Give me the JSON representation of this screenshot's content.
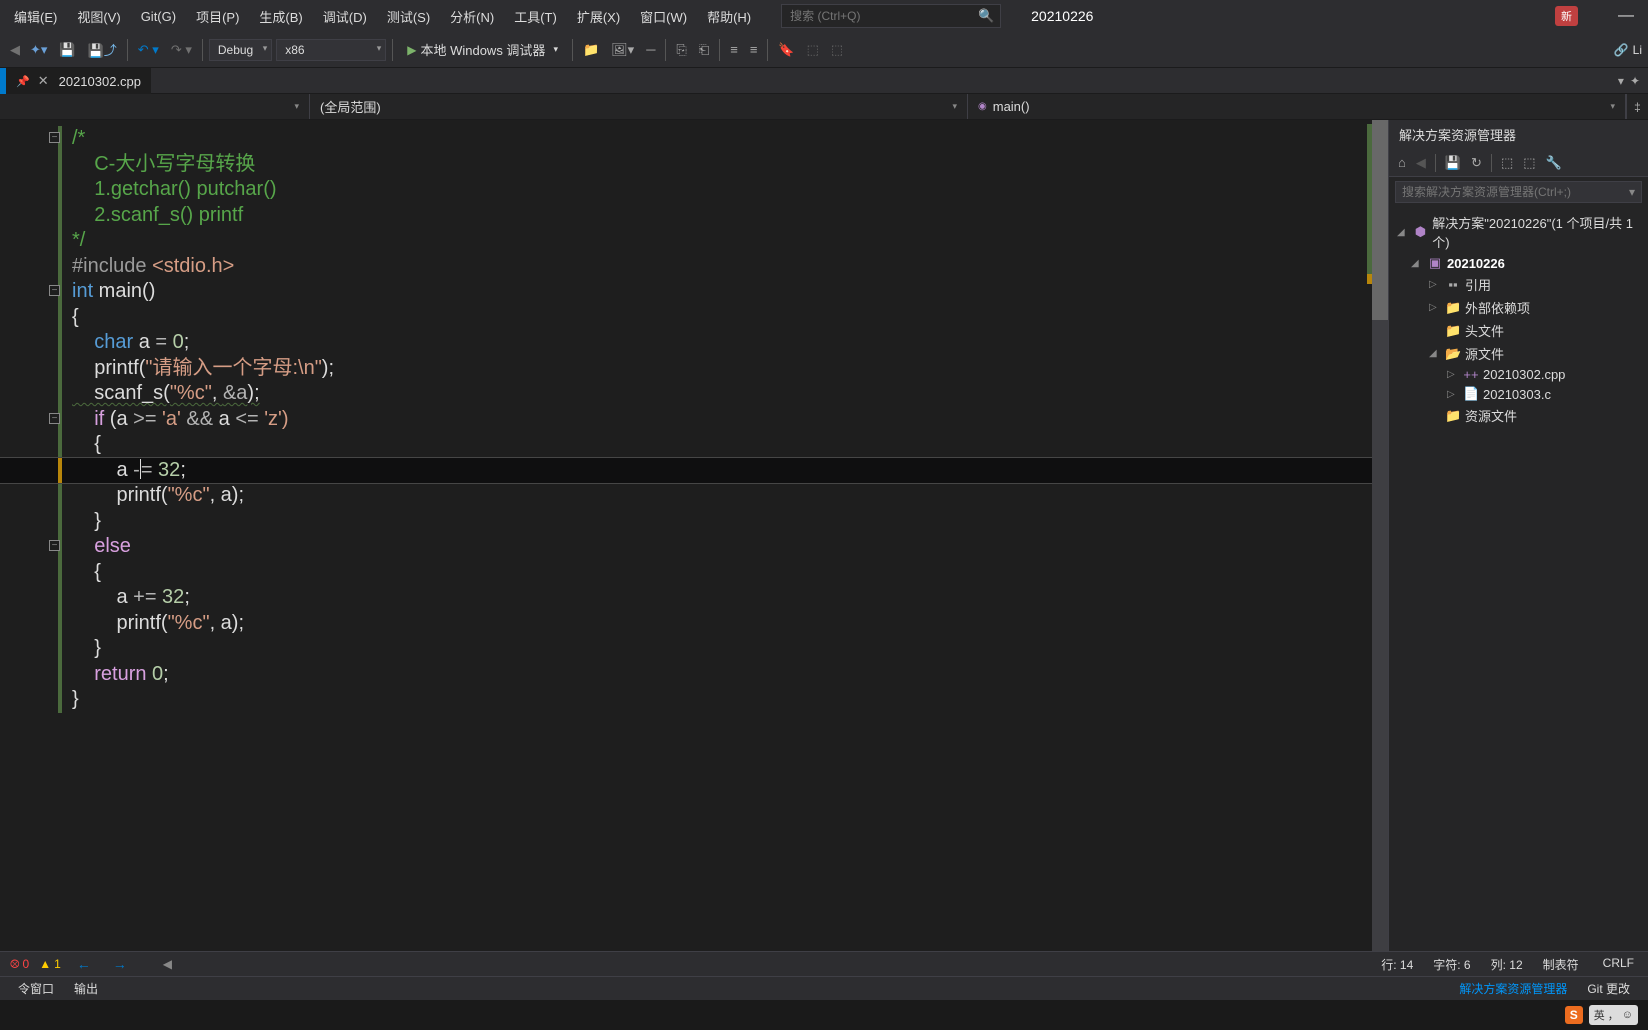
{
  "menus": {
    "edit": "编辑(E)",
    "view": "视图(V)",
    "git": "Git(G)",
    "project": "项目(P)",
    "build": "生成(B)",
    "debug": "调试(D)",
    "test": "测试(S)",
    "analyze": "分析(N)",
    "tools": "工具(T)",
    "extensions": "扩展(X)",
    "window": "窗口(W)",
    "help": "帮助(H)"
  },
  "search": {
    "placeholder": "搜索 (Ctrl+Q)"
  },
  "project_name": "20210226",
  "new_badge": "新",
  "toolbar": {
    "config": "Debug",
    "platform": "x86",
    "debugger": "本地 Windows 调试器",
    "live": "Li"
  },
  "tabs": {
    "file": "20210302.cpp"
  },
  "navbar": {
    "scope": "(全局范围)",
    "func_icon": "⬤",
    "func": "main()"
  },
  "code": {
    "l1": "/*",
    "l2": "    C-大小写字母转换",
    "l3": "    1.getchar() putchar()",
    "l4": "    2.scanf_s() printf",
    "l5": "*/",
    "l6a": "#include ",
    "l6b": "<stdio.h>",
    "l7a": "int",
    "l7b": " main()",
    "l8": "{",
    "l9a": "    char",
    "l9b": " a ",
    "l9c": "=",
    "l9d": " 0",
    "l9e": ";",
    "l10a": "    printf(",
    "l10b": "\"请输入一个字母:\\n\"",
    "l10c": ");",
    "l11a": "    scanf_s",
    "l11b": "(",
    "l11c": "\"%c\"",
    "l11d": ", ",
    "l11e": "&a",
    "l11f": ");",
    "l12a": "    if",
    "l12b": " (a ",
    "l12c": ">=",
    "l12d": " 'a' ",
    "l12e": "&&",
    "l12f": " a ",
    "l12g": "<=",
    "l12h": " 'z')",
    "l13": "    {",
    "l14a": "        a ",
    "l14b": "-",
    "l14c": "=",
    "l14d": " 32",
    "l14e": ";",
    "l15a": "        printf(",
    "l15b": "\"%c\"",
    "l15c": ", a);",
    "l16": "    }",
    "l17a": "    else",
    "l18": "    {",
    "l19a": "        a ",
    "l19b": "+=",
    "l19c": " 32",
    "l19d": ";",
    "l20a": "        printf(",
    "l20b": "\"%c\"",
    "l20c": ", a);",
    "l21": "    }",
    "l22a": "    return",
    "l22b": " 0",
    "l22c": ";",
    "l23": "}"
  },
  "solution": {
    "title": "解决方案资源管理器",
    "search_placeholder": "搜索解决方案资源管理器(Ctrl+;)",
    "root": "解决方案\"20210226\"(1 个项目/共 1 个)",
    "project": "20210226",
    "refs": "引用",
    "external": "外部依赖项",
    "headers": "头文件",
    "sources": "源文件",
    "file1": "20210302.cpp",
    "file2": "20210303.c",
    "resources": "资源文件"
  },
  "errors": {
    "count": "0",
    "warn": "1"
  },
  "status": {
    "line": "行: 14",
    "char": "字符: 6",
    "col": "列: 12",
    "tabs": "制表符",
    "crlf": "CRLF"
  },
  "bottom": {
    "cmd": "令窗口",
    "output": "输出",
    "sln_tab": "解决方案资源管理器",
    "git_tab": "Git 更改"
  },
  "ime": {
    "s": "S",
    "lang": "英",
    "punct": "，",
    "smile": "☺"
  }
}
